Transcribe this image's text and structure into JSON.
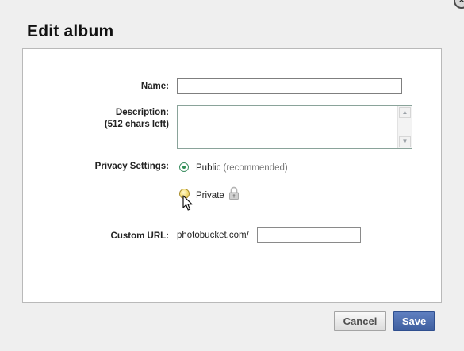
{
  "dialog": {
    "title": "Edit album",
    "close_glyph": "×"
  },
  "form": {
    "name_label": "Name:",
    "name_value": "",
    "description_label": "Description:",
    "description_hint": "(512 chars left)",
    "description_value": "",
    "privacy_label": "Privacy Settings:",
    "privacy_options": [
      {
        "label": "Public",
        "note": "(recommended)",
        "selected": true
      },
      {
        "label": "Private",
        "note": "",
        "selected": false
      }
    ],
    "custom_url_label": "Custom URL:",
    "custom_url_prefix": "photobucket.com/",
    "custom_url_value": ""
  },
  "buttons": {
    "cancel": "Cancel",
    "save": "Save"
  },
  "icons": {
    "lock": "lock-icon",
    "cursor": "mouse-pointer-icon",
    "scroll_up": "chevron-up-icon",
    "scroll_down": "chevron-down-icon"
  },
  "colors": {
    "primary_button": "#3f5f9f",
    "primary_button_text": "#ffffff",
    "selected_radio": "#2f8f54",
    "hover_radio": "#f3dd78"
  }
}
